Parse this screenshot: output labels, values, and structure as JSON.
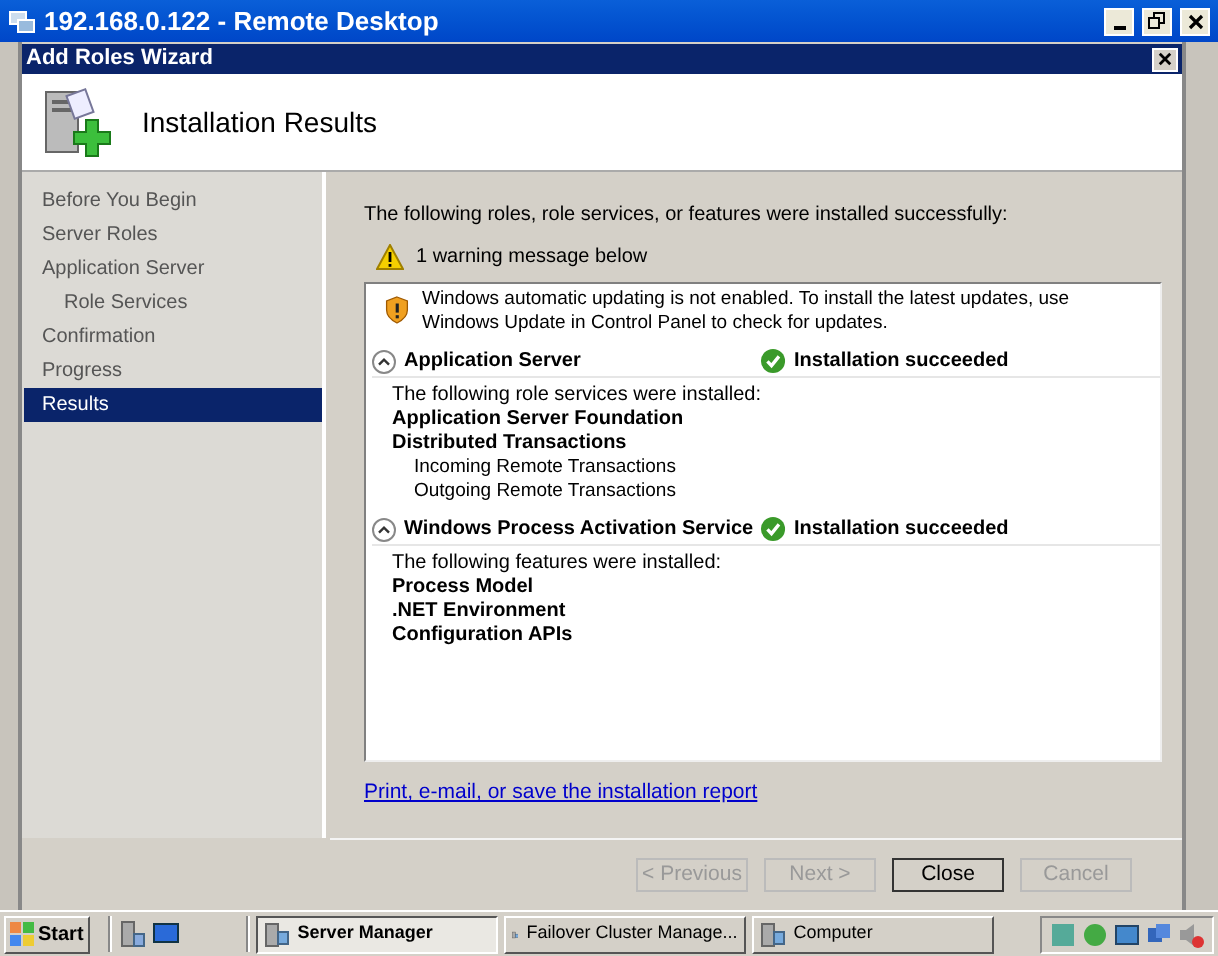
{
  "remote_window": {
    "title": "192.168.0.122 - Remote Desktop"
  },
  "wizard": {
    "title": "Add Roles Wizard",
    "heading": "Installation Results"
  },
  "steps": [
    {
      "label": "Before You Begin",
      "selected": false
    },
    {
      "label": "Server Roles",
      "selected": false
    },
    {
      "label": "Application Server",
      "selected": false,
      "children": [
        {
          "label": "Role Services",
          "selected": false
        }
      ]
    },
    {
      "label": "Confirmation",
      "selected": false
    },
    {
      "label": "Progress",
      "selected": false
    },
    {
      "label": "Results",
      "selected": true
    }
  ],
  "intro": "The following roles, role services, or features were installed successfully:",
  "warning_summary": "1 warning message below",
  "warning": "Windows automatic updating is not enabled. To install the latest updates, use Windows Update in Control Panel to check for updates.",
  "sections": [
    {
      "title": "Application Server",
      "status": "Installation succeeded",
      "expanded": true,
      "caption": "The following role services were installed:",
      "items": [
        {
          "label": "Application Server Foundation"
        },
        {
          "label": "Distributed Transactions",
          "children": [
            {
              "label": "Incoming Remote Transactions"
            },
            {
              "label": "Outgoing Remote Transactions"
            }
          ]
        }
      ]
    },
    {
      "title": "Windows Process Activation Service",
      "status": "Installation succeeded",
      "expanded": true,
      "caption": "The following features were installed:",
      "items": [
        {
          "label": "Process Model"
        },
        {
          "label": ".NET Environment"
        },
        {
          "label": "Configuration APIs"
        }
      ]
    }
  ],
  "report_link": "Print, e-mail, or save the installation report",
  "buttons": [
    {
      "label": "< Previous",
      "disabled": true
    },
    {
      "label": "Next >",
      "disabled": true
    },
    {
      "label": "Close",
      "disabled": false
    },
    {
      "label": "Cancel",
      "disabled": true
    }
  ],
  "taskbar": {
    "start": "Start",
    "tasks": [
      {
        "label": "Server Manager",
        "selected": true
      },
      {
        "label": "Failover Cluster Manage...",
        "selected": false
      },
      {
        "label": "Computer",
        "selected": false
      }
    ]
  }
}
